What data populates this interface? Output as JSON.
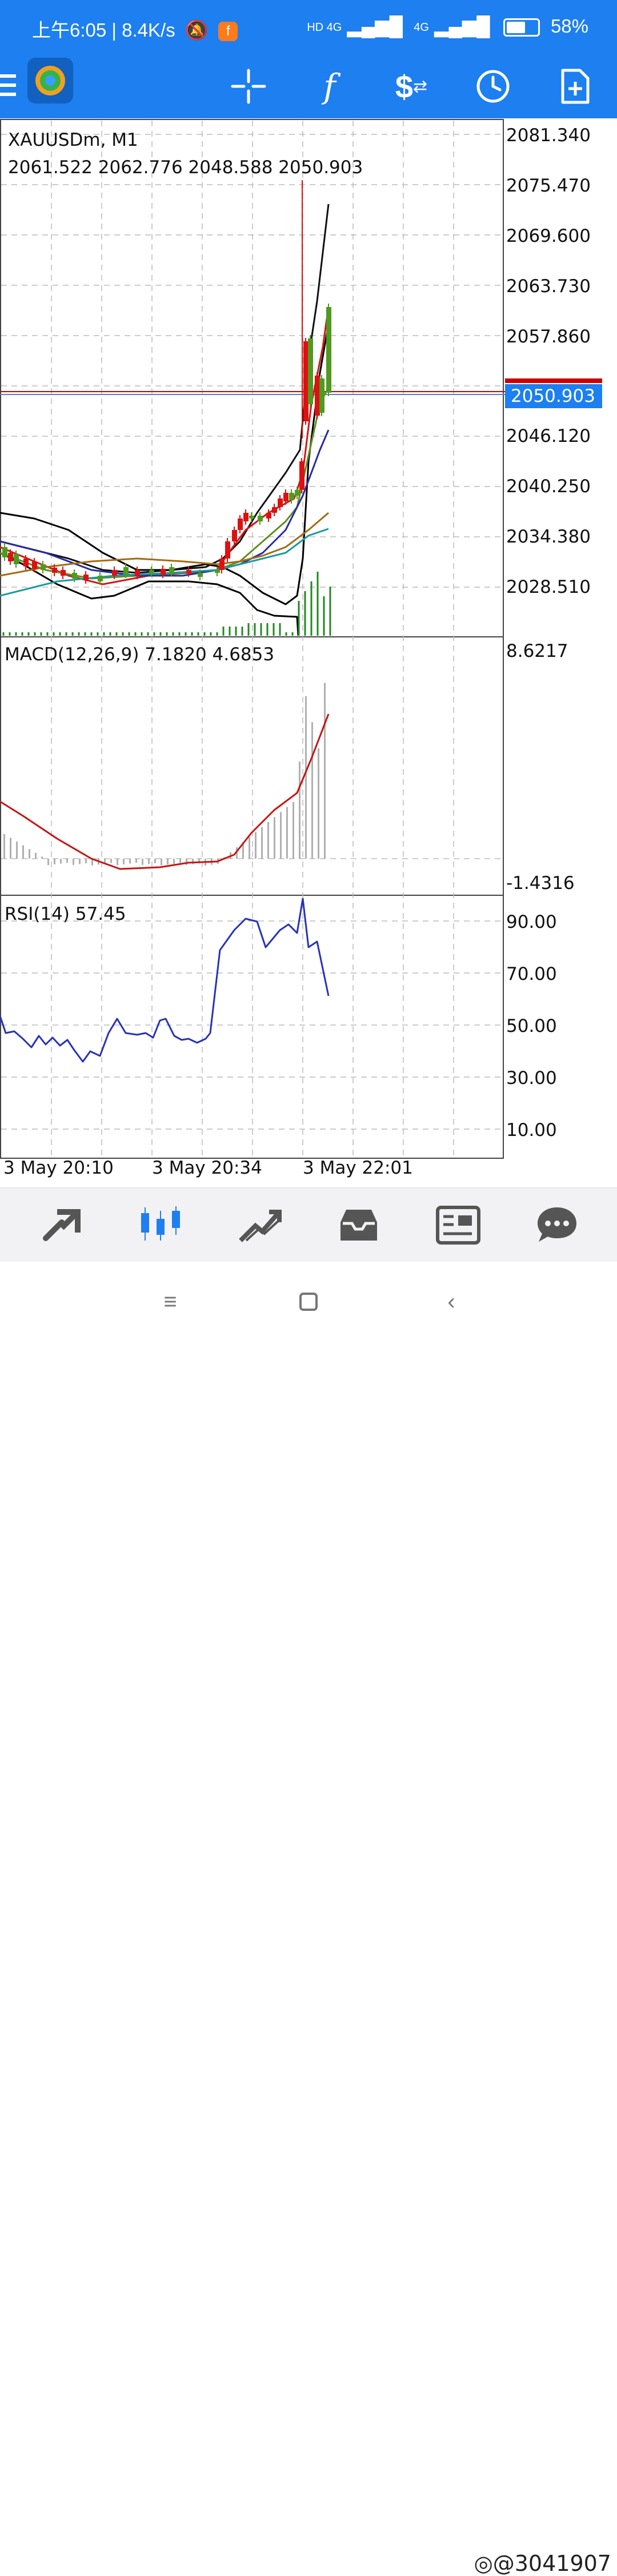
{
  "status_bar": {
    "time": "上午6:05",
    "speed": "8.4K/s",
    "network1": "HD 4G",
    "network2": "4G",
    "battery": "58%"
  },
  "toolbar": {
    "icons": [
      "menu-icon",
      "app-logo",
      "crosshair-icon",
      "function-icon",
      "trade-icon",
      "clock-icon",
      "add-document-icon"
    ]
  },
  "chart": {
    "symbol": "XAUUSDm, M1",
    "ohlc": "2061.522 2062.776 2048.588 2050.903",
    "current_price": "2050.903",
    "price_axis": [
      "2081.340",
      "2075.470",
      "2069.600",
      "2063.730",
      "2057.860",
      "2046.120",
      "2040.250",
      "2034.380",
      "2028.510"
    ],
    "macd_label": "MACD(12,26,9) 7.1820 4.6853",
    "macd_axis": [
      "8.6217",
      "-1.4316"
    ],
    "rsi_label": "RSI(14) 57.45",
    "rsi_axis": [
      "90.00",
      "70.00",
      "50.00",
      "30.00",
      "10.00"
    ],
    "time_axis": [
      "3 May 20:10",
      "3 May 20:34",
      "3 May 22:01"
    ]
  },
  "bottom_nav": {
    "items": [
      "quotes-icon",
      "chart-icon",
      "trade-icon",
      "history-icon",
      "news-icon",
      "chat-icon"
    ],
    "active": "chart-icon"
  },
  "system_nav": {
    "watermark": "@3041907"
  },
  "colors": {
    "accent": "#1d7ff0",
    "bull": "#4f9a1f",
    "bear": "#dd1111",
    "rsi": "#2832b8",
    "macd_signal": "#c81414"
  }
}
